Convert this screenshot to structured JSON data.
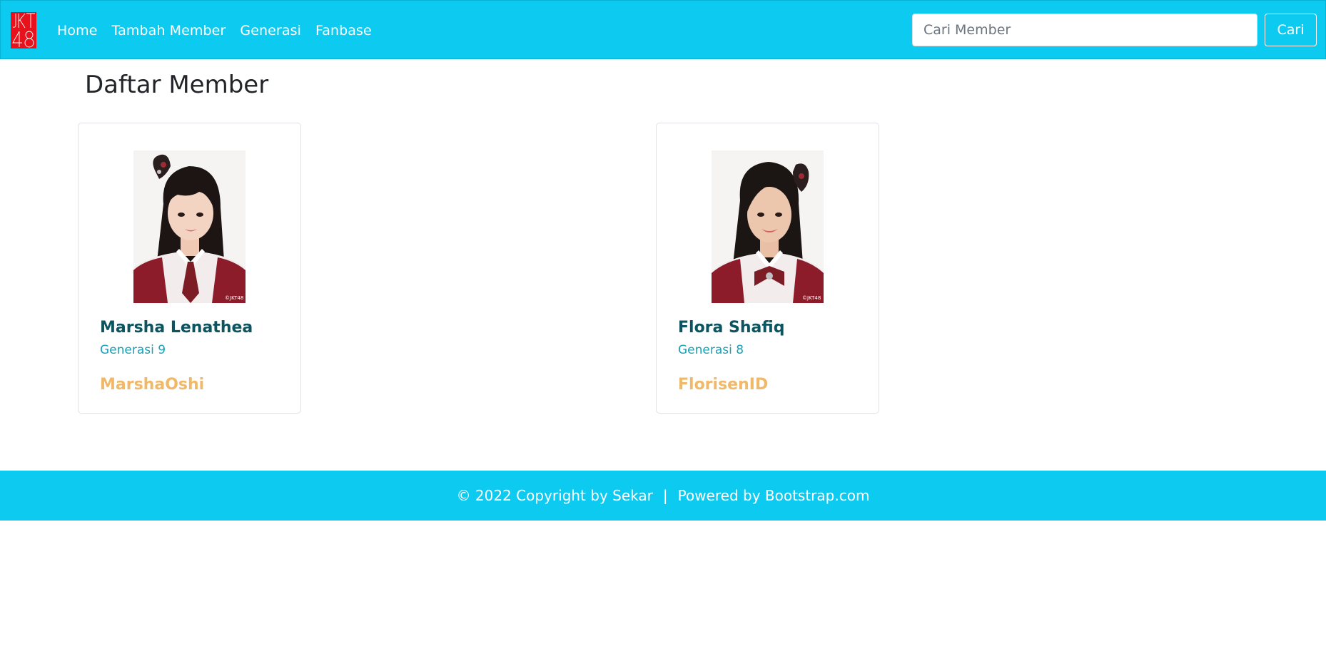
{
  "navbar": {
    "logo_text": "JKT48",
    "links": [
      "Home",
      "Tambah Member",
      "Generasi",
      "Fanbase"
    ],
    "search_placeholder": "Cari Member",
    "search_value": "",
    "search_button": "Cari"
  },
  "main": {
    "title": "Daftar Member",
    "members": [
      {
        "name": "Marsha Lenathea",
        "generation": "Generasi 9",
        "fanbase": "MarshaOshi",
        "watermark": "©JKT48"
      },
      {
        "name": "Flora Shafiq",
        "generation": "Generasi 8",
        "fanbase": "FlorisenID",
        "watermark": "©JKT48"
      }
    ]
  },
  "footer": {
    "copyright": "© 2022 Copyright by Sekar",
    "separator": "|",
    "powered": "Powered by Bootstrap.com"
  },
  "colors": {
    "navbar_bg": "#0dcaf0",
    "logo_red": "#e8121d",
    "name_color": "#0c5460",
    "generation_color": "#17a2b8",
    "fanbase_color": "#f0b96a"
  }
}
